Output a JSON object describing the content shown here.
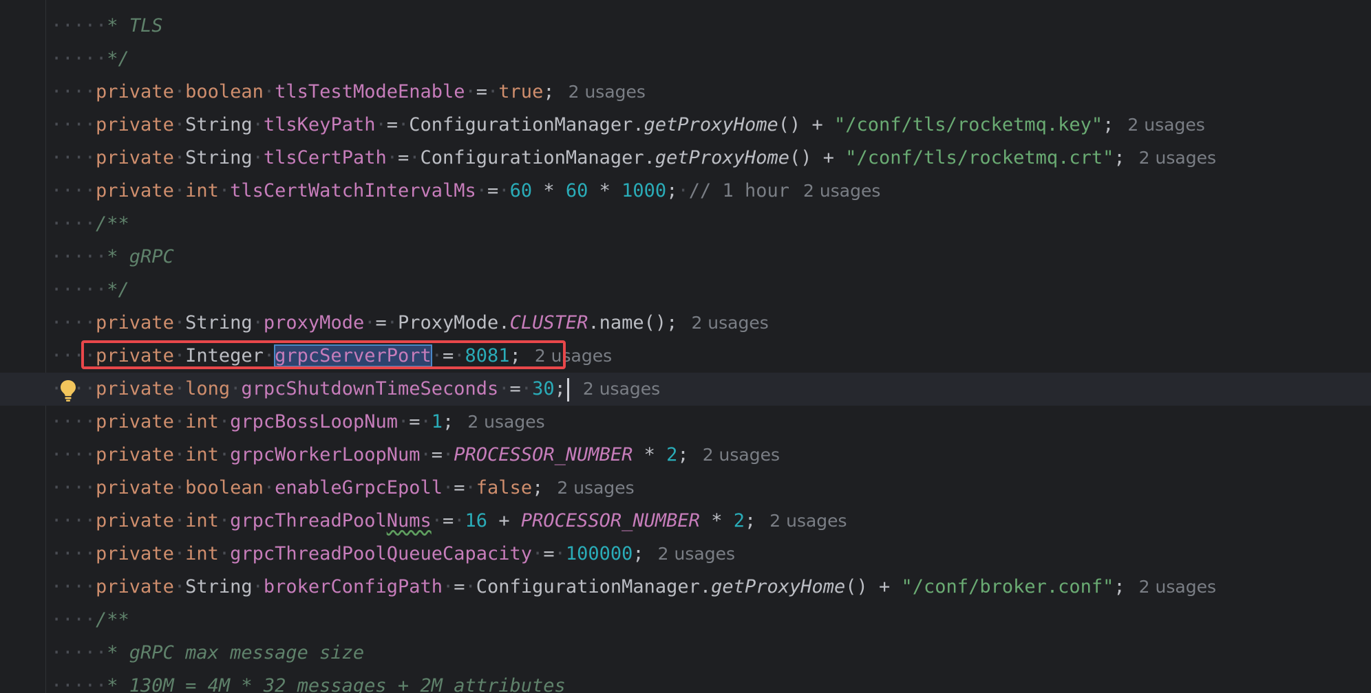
{
  "hint_label": "2 usages",
  "lines": {
    "l0": {
      "doc": "* TLS"
    },
    "l1": {
      "doc": "*/"
    },
    "l2": {
      "kw": "private",
      "type": "boolean",
      "field": "tlsTestModeEnable",
      "eq": "=",
      "val": "true",
      "semi": ";"
    },
    "l3": {
      "kw": "private",
      "type": "String",
      "field": "tlsKeyPath",
      "eq": "=",
      "cls": "ConfigurationManager.",
      "mth": "getProxyHome",
      "call": "() + ",
      "str": "\"/conf/tls/rocketmq.key\"",
      "semi": ";"
    },
    "l4": {
      "kw": "private",
      "type": "String",
      "field": "tlsCertPath",
      "eq": "=",
      "cls": "ConfigurationManager.",
      "mth": "getProxyHome",
      "call": "() + ",
      "str": "\"/conf/tls/rocketmq.crt\"",
      "semi": ";"
    },
    "l5": {
      "kw": "private",
      "type": "int",
      "field": "tlsCertWatchIntervalMs",
      "eq": "=",
      "n1": "60",
      "op1": " * ",
      "n2": "60",
      "op2": " * ",
      "n3": "1000",
      "semi": ";",
      "comment": "// 1 hour"
    },
    "l6": {
      "doc": "/**"
    },
    "l7": {
      "doc": "* gRPC"
    },
    "l8": {
      "doc": "*/"
    },
    "l9": {
      "kw": "private",
      "type": "String",
      "field": "proxyMode",
      "eq": "=",
      "cls": "ProxyMode.",
      "cst": "CLUSTER",
      "call": ".name()",
      "semi": ";"
    },
    "l10": {
      "kw": "private",
      "type": "Integer",
      "field": "grpcServerPort",
      "eq": "=",
      "val": "8081",
      "semi": ";"
    },
    "l11": {
      "kw": "private",
      "type": "long",
      "field": "grpcShutdownTimeSeconds",
      "eq": "=",
      "val": "30",
      "semi": ";"
    },
    "l12": {
      "kw": "private",
      "type": "int",
      "field": "grpcBossLoopNum",
      "eq": "=",
      "val": "1",
      "semi": ";"
    },
    "l13": {
      "kw": "private",
      "type": "int",
      "field": "grpcWorkerLoopNum",
      "eq": "=",
      "cst": "PROCESSOR_NUMBER",
      "op": " * ",
      "val": "2",
      "semi": ";"
    },
    "l14": {
      "kw": "private",
      "type": "boolean",
      "field": "enableGrpcEpoll",
      "eq": "=",
      "val": "false",
      "semi": ";"
    },
    "l15": {
      "kw": "private",
      "type": "int",
      "field_a": "grpcThreadPool",
      "field_b": "Nums",
      "eq": "=",
      "n1": "16",
      "op1": " + ",
      "cst": "PROCESSOR_NUMBER",
      "op2": " * ",
      "n2": "2",
      "semi": ";"
    },
    "l16": {
      "kw": "private",
      "type": "int",
      "field": "grpcThreadPoolQueueCapacity",
      "eq": "=",
      "val": "100000",
      "semi": ";"
    },
    "l17": {
      "kw": "private",
      "type": "String",
      "field": "brokerConfigPath",
      "eq": "=",
      "cls": "ConfigurationManager.",
      "mth": "getProxyHome",
      "call": "() + ",
      "str": "\"/conf/broker.conf\"",
      "semi": ";"
    },
    "l18": {
      "doc": "/**"
    },
    "l19": {
      "doc": "* gRPC max message size"
    },
    "l20": {
      "doc": "* 130M = 4M * 32 messages + 2M attributes"
    }
  },
  "colors": {
    "background": "#1e1f22",
    "keyword": "#cf8e6d",
    "field": "#c77dbb",
    "number": "#2aacb8",
    "string": "#6aab73",
    "doc_comment": "#5f826b",
    "highlight_box": "#e8474a"
  },
  "icons": {
    "intention_bulb": "lightbulb-icon"
  }
}
